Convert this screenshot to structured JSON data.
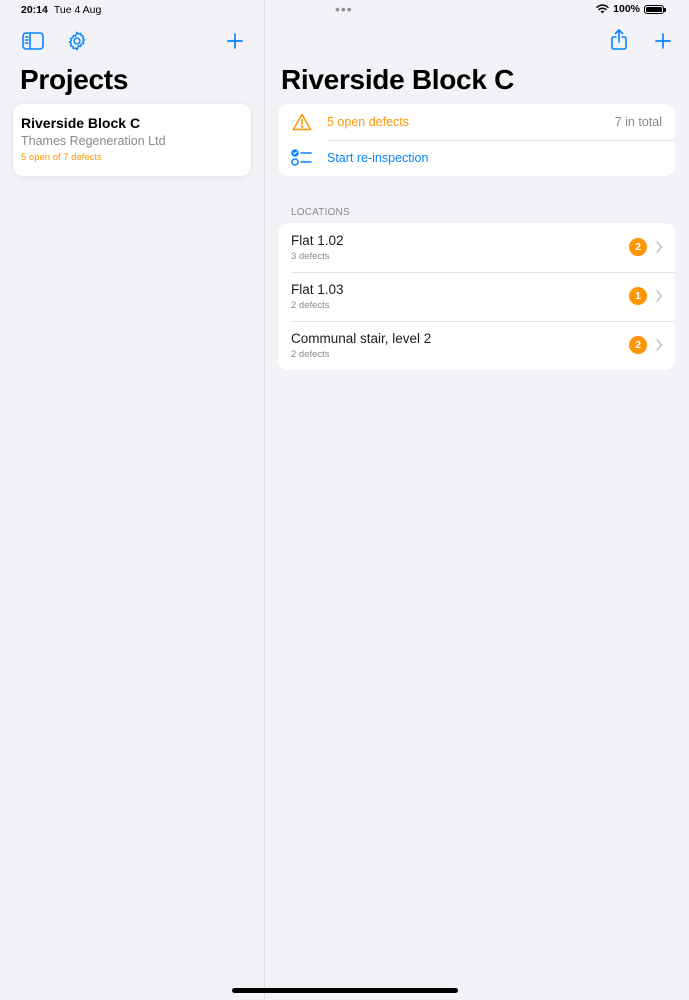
{
  "status_bar": {
    "time": "20:14",
    "date": "Tue 4 Aug",
    "dots": "•••",
    "battery": "100%"
  },
  "sidebar": {
    "title": "Projects",
    "projects": [
      {
        "name": "Riverside Block C",
        "client": "Thames Regeneration Ltd",
        "status": "5 open of 7 defects"
      }
    ]
  },
  "detail": {
    "title": "Riverside Block C",
    "summary": {
      "open_defects": "5 open defects",
      "total": "7 in total",
      "reinspect": "Start re-inspection"
    },
    "locations_header": "LOCATIONS",
    "locations": [
      {
        "name": "Flat 1.02",
        "sub": "3 defects",
        "badge": "2"
      },
      {
        "name": "Flat 1.03",
        "sub": "2 defects",
        "badge": "1"
      },
      {
        "name": "Communal stair, level 2",
        "sub": "2 defects",
        "badge": "2"
      }
    ]
  },
  "colors": {
    "accent": "#0a84ff",
    "warning": "#ff9500",
    "background": "#f2f2f7",
    "secondary_text": "#8a8a8e"
  },
  "icons": {
    "sidebar_toggle": "sidebar-icon",
    "settings": "gear-icon",
    "add": "plus-icon",
    "share": "share-icon",
    "warning": "warning-triangle-icon",
    "checklist": "checklist-icon",
    "chevron": "chevron-right-icon",
    "wifi": "wifi-icon",
    "battery": "battery-icon"
  }
}
